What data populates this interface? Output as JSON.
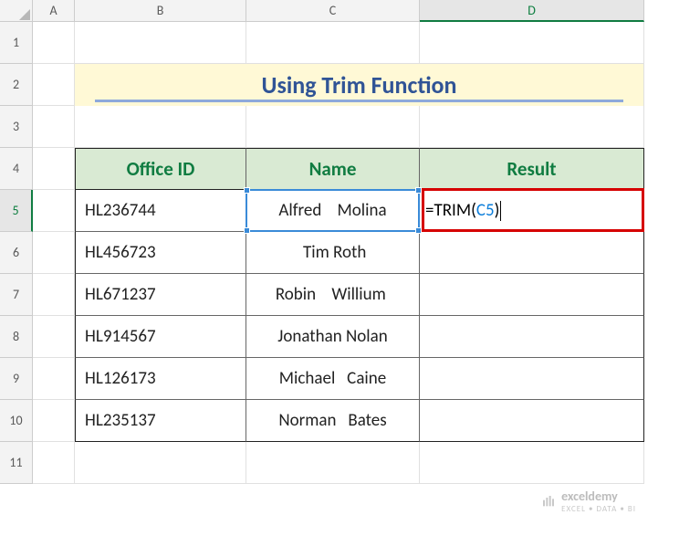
{
  "columns": [
    "A",
    "B",
    "C",
    "D"
  ],
  "rows": [
    "1",
    "2",
    "3",
    "4",
    "5",
    "6",
    "7",
    "8",
    "9",
    "10",
    "11"
  ],
  "active_column": "D",
  "active_row": "5",
  "title": "Using Trim Function",
  "headers": {
    "office_id": "Office ID",
    "name": "Name",
    "result": "Result"
  },
  "data_rows": [
    {
      "office_id": "HL236744",
      "name": " Alfred    Molina "
    },
    {
      "office_id": "HL456723",
      "name": " Tim Roth"
    },
    {
      "office_id": "HL671237",
      "name": "Robin    Willium "
    },
    {
      "office_id": "HL914567",
      "name": "Jonathan Nolan"
    },
    {
      "office_id": "HL126173",
      "name": " Michael   Caine "
    },
    {
      "office_id": "HL235137",
      "name": "Norman   Bates"
    }
  ],
  "formula": {
    "prefix": "=TRIM(",
    "ref": "C5",
    "suffix": ")"
  },
  "watermark": {
    "brand": "exceldemy",
    "tagline": "EXCEL • DATA • BI"
  }
}
